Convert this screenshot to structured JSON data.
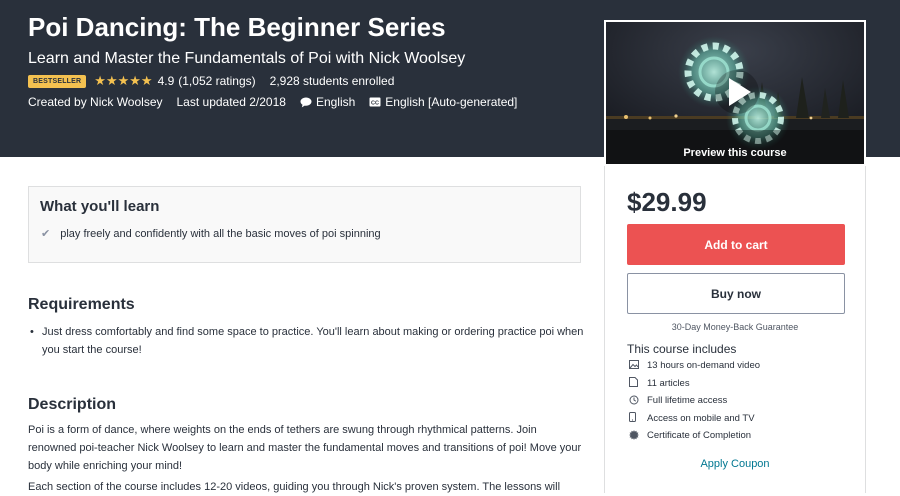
{
  "course": {
    "title": "Poi Dancing: The Beginner Series",
    "subtitle": "Learn and Master the Fundamentals of Poi with Nick Woolsey",
    "badge": "BESTSELLER",
    "rating": "4.9",
    "ratings_count": "(1,052 ratings)",
    "stars": 5,
    "enrolled": "2,928 students enrolled",
    "created_by": "Created by Nick Woolsey",
    "last_updated": "Last updated 2/2018",
    "language": "English",
    "captions": "English [Auto-generated]"
  },
  "preview": {
    "label": "Preview this course"
  },
  "sidebar": {
    "price": "$29.99",
    "add_to_cart": "Add to cart",
    "buy_now": "Buy now",
    "guarantee": "30-Day Money-Back Guarantee",
    "includes_title": "This course includes",
    "includes": [
      {
        "icon": "video-icon",
        "text": "13 hours on-demand video"
      },
      {
        "icon": "file-icon",
        "text": "11 articles"
      },
      {
        "icon": "infinity-icon",
        "text": "Full lifetime access"
      },
      {
        "icon": "mobile-icon",
        "text": "Access on mobile and TV"
      },
      {
        "icon": "certificate-icon",
        "text": "Certificate of Completion"
      }
    ],
    "apply_coupon": "Apply Coupon"
  },
  "learn": {
    "title": "What you'll learn",
    "items": [
      "play freely and confidently with all the basic moves of poi spinning"
    ]
  },
  "requirements": {
    "title": "Requirements",
    "items": [
      "Just dress comfortably and find some space to practice. You'll learn about making or ordering practice poi when you start the course!"
    ]
  },
  "description": {
    "title": "Description",
    "paragraphs": [
      "Poi is a form of dance, where weights on the ends of tethers are swung through rhythmical patterns. Join renowned poi-teacher Nick Woolsey to learn and master the fundamental moves and transitions of poi! Move your body while enriching your mind!",
      "Each section of the course includes 12-20 videos, guiding you through Nick's proven system. The lessons will"
    ]
  },
  "colors": {
    "hero_bg": "#29303b",
    "star": "#f4c150",
    "cart_button": "#ec5252",
    "link": "#007791"
  }
}
